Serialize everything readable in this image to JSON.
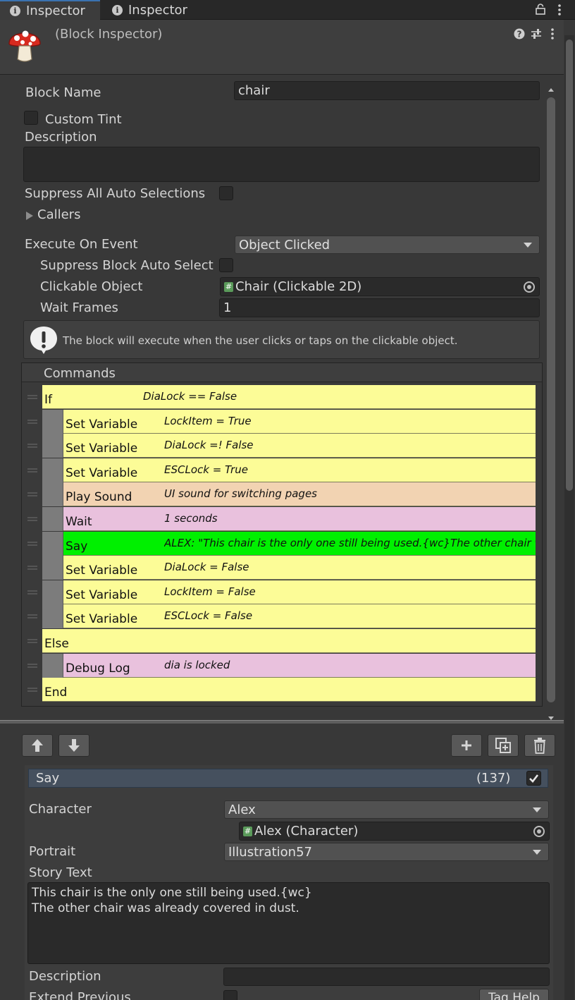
{
  "tabs": [
    {
      "label": "Inspector"
    },
    {
      "label": "Inspector"
    }
  ],
  "header": {
    "title": "(Block Inspector)"
  },
  "block": {
    "name_label": "Block Name",
    "name_value": "chair",
    "custom_tint_label": "Custom Tint",
    "description_label": "Description",
    "description_value": "",
    "suppress_all_label": "Suppress All Auto Selections",
    "callers_label": "Callers",
    "execute_label": "Execute On Event",
    "execute_value": "Object Clicked",
    "suppress_block_label": "Suppress Block Auto Select",
    "clickable_label": "Clickable Object",
    "clickable_value": "Chair (Clickable 2D)",
    "wait_frames_label": "Wait Frames",
    "wait_frames_value": "1",
    "help_text": "The block will execute when the user clicks or taps on the clickable object."
  },
  "commands": {
    "title": "Commands",
    "rows": [
      {
        "name": "If",
        "summary": "DiaLock == False",
        "color": "#fcfc97",
        "indent": 0
      },
      {
        "name": "Set Variable",
        "summary": "LockItem = True",
        "color": "#fcfc97",
        "indent": 1
      },
      {
        "name": "Set Variable",
        "summary": "DiaLock =! False",
        "color": "#fcfc97",
        "indent": 1
      },
      {
        "name": "Set Variable",
        "summary": "ESCLock = True",
        "color": "#fcfc97",
        "indent": 1
      },
      {
        "name": "Play Sound",
        "summary": "UI sound for switching pages",
        "color": "#f2d3b2",
        "indent": 1
      },
      {
        "name": "Wait",
        "summary": "1 seconds",
        "color": "#e9c1dd",
        "indent": 1
      },
      {
        "name": "Say",
        "summary": "ALEX: \"This chair is the only one still being used.{wc}The other chair was",
        "color": "#00f000",
        "indent": 1
      },
      {
        "name": "Set Variable",
        "summary": "DiaLock = False",
        "color": "#fcfc97",
        "indent": 1
      },
      {
        "name": "Set Variable",
        "summary": "LockItem = False",
        "color": "#fcfc97",
        "indent": 1
      },
      {
        "name": "Set Variable",
        "summary": "ESCLock = False",
        "color": "#fcfc97",
        "indent": 1
      },
      {
        "name": "Else",
        "summary": "",
        "color": "#fcfc97",
        "indent": 0
      },
      {
        "name": "Debug Log",
        "summary": "dia is locked",
        "color": "#e9c1dd",
        "indent": 1
      },
      {
        "name": "End",
        "summary": "",
        "color": "#fcfc97",
        "indent": 0
      }
    ]
  },
  "toolbar": {
    "up_icon": "arrow-up-icon",
    "down_icon": "arrow-down-icon",
    "add_icon": "plus-icon",
    "duplicate_icon": "duplicate-icon",
    "delete_icon": "trash-icon"
  },
  "say": {
    "title": "Say",
    "count": "(137)",
    "character_label": "Character",
    "character_value": "Alex",
    "character_object": "Alex (Character)",
    "portrait_label": "Portrait",
    "portrait_value": "Illustration57",
    "story_label": "Story Text",
    "story_line1": "This chair is the only one still being used.{wc}",
    "story_line2": "The other chair was already covered in dust.",
    "description_label": "Description",
    "extend_label": "Extend Previous",
    "tag_help_label": "Tag Help"
  },
  "colors": {
    "yellow": "#fcfc97",
    "peach": "#f2d3b2",
    "pink": "#e9c1dd",
    "green": "#00f000"
  }
}
